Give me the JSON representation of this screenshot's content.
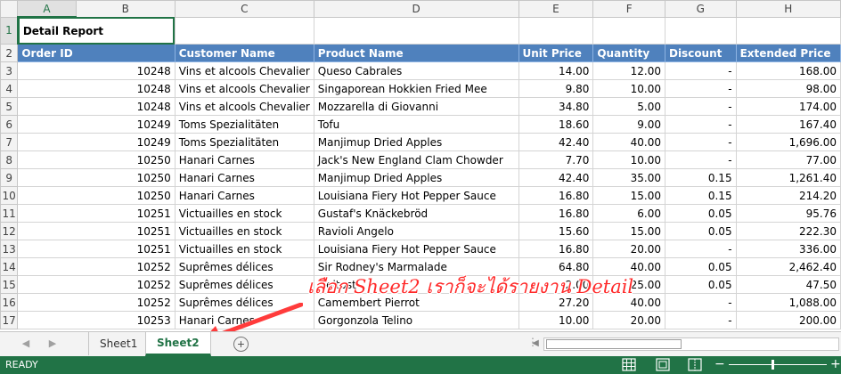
{
  "columns": [
    "A",
    "B",
    "C",
    "D",
    "E",
    "F",
    "G",
    "H"
  ],
  "report_title": "Detail Report",
  "headers": [
    "Order ID",
    "Customer Name",
    "Product Name",
    "Unit Price",
    "Quantity",
    "Discount",
    "Extended Price"
  ],
  "rows": [
    {
      "n": "3",
      "id": "10248",
      "customer": "Vins et alcools Chevalier",
      "product": "Queso Cabrales",
      "price": "14.00",
      "qty": "12.00",
      "disc": "-",
      "ext": "168.00"
    },
    {
      "n": "4",
      "id": "10248",
      "customer": "Vins et alcools Chevalier",
      "product": "Singaporean Hokkien Fried Mee",
      "price": "9.80",
      "qty": "10.00",
      "disc": "-",
      "ext": "98.00"
    },
    {
      "n": "5",
      "id": "10248",
      "customer": "Vins et alcools Chevalier",
      "product": "Mozzarella di Giovanni",
      "price": "34.80",
      "qty": "5.00",
      "disc": "-",
      "ext": "174.00"
    },
    {
      "n": "6",
      "id": "10249",
      "customer": "Toms Spezialitäten",
      "product": "Tofu",
      "price": "18.60",
      "qty": "9.00",
      "disc": "-",
      "ext": "167.40"
    },
    {
      "n": "7",
      "id": "10249",
      "customer": "Toms Spezialitäten",
      "product": "Manjimup Dried Apples",
      "price": "42.40",
      "qty": "40.00",
      "disc": "-",
      "ext": "1,696.00"
    },
    {
      "n": "8",
      "id": "10250",
      "customer": "Hanari Carnes",
      "product": "Jack's New England Clam Chowder",
      "price": "7.70",
      "qty": "10.00",
      "disc": "-",
      "ext": "77.00"
    },
    {
      "n": "9",
      "id": "10250",
      "customer": "Hanari Carnes",
      "product": "Manjimup Dried Apples",
      "price": "42.40",
      "qty": "35.00",
      "disc": "0.15",
      "ext": "1,261.40"
    },
    {
      "n": "10",
      "id": "10250",
      "customer": "Hanari Carnes",
      "product": "Louisiana Fiery Hot Pepper Sauce",
      "price": "16.80",
      "qty": "15.00",
      "disc": "0.15",
      "ext": "214.20"
    },
    {
      "n": "11",
      "id": "10251",
      "customer": "Victuailles en stock",
      "product": "Gustaf's Knäckebröd",
      "price": "16.80",
      "qty": "6.00",
      "disc": "0.05",
      "ext": "95.76"
    },
    {
      "n": "12",
      "id": "10251",
      "customer": "Victuailles en stock",
      "product": "Ravioli Angelo",
      "price": "15.60",
      "qty": "15.00",
      "disc": "0.05",
      "ext": "222.30"
    },
    {
      "n": "13",
      "id": "10251",
      "customer": "Victuailles en stock",
      "product": "Louisiana Fiery Hot Pepper Sauce",
      "price": "16.80",
      "qty": "20.00",
      "disc": "-",
      "ext": "336.00"
    },
    {
      "n": "14",
      "id": "10252",
      "customer": "Suprêmes délices",
      "product": "Sir Rodney's Marmalade",
      "price": "64.80",
      "qty": "40.00",
      "disc": "0.05",
      "ext": "2,462.40"
    },
    {
      "n": "15",
      "id": "10252",
      "customer": "Suprêmes délices",
      "product": "Geitost",
      "price": "2.00",
      "qty": "25.00",
      "disc": "0.05",
      "ext": "47.50"
    },
    {
      "n": "16",
      "id": "10252",
      "customer": "Suprêmes délices",
      "product": "Camembert Pierrot",
      "price": "27.20",
      "qty": "40.00",
      "disc": "-",
      "ext": "1,088.00"
    },
    {
      "n": "17",
      "id": "10253",
      "customer": "Hanari Carnes",
      "product": "Gorgonzola Telino",
      "price": "10.00",
      "qty": "20.00",
      "disc": "-",
      "ext": "200.00"
    }
  ],
  "annotation": "เลือก Sheet2 เราก็จะได้รายงาน Detail",
  "sheets": [
    "Sheet1",
    "Sheet2"
  ],
  "active_sheet": "Sheet2",
  "add_sheet_symbol": "+",
  "status": "READY",
  "colors": {
    "accent": "#217346",
    "header_fill": "#4f81bd",
    "annotation": "#ff2a2a"
  }
}
